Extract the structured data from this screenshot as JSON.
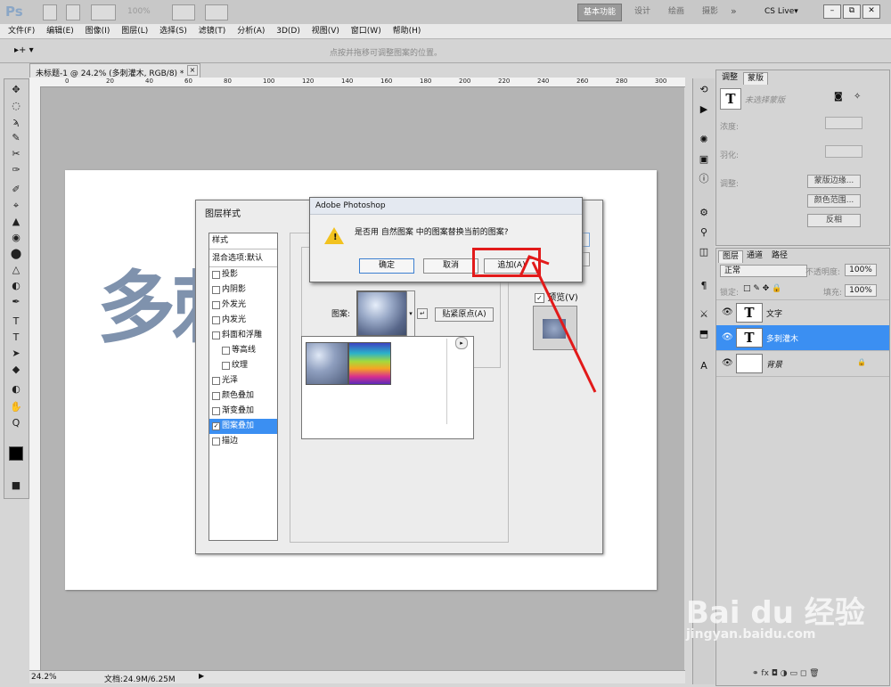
{
  "appbar": {
    "logo": "Ps",
    "zoom_field": "100%",
    "workspaces": [
      "基本功能",
      "设计",
      "绘画",
      "摄影"
    ],
    "more": "»",
    "cs_live": "CS Live▾",
    "win_min": "–",
    "win_max": "⧉",
    "win_close": "✕"
  },
  "menu": [
    "文件(F)",
    "编辑(E)",
    "图像(I)",
    "图层(L)",
    "选择(S)",
    "滤镜(T)",
    "分析(A)",
    "3D(D)",
    "视图(V)",
    "窗口(W)",
    "帮助(H)"
  ],
  "options": {
    "tool_glyph": "▸+ ▾",
    "hint": "点按并拖移可调整图案的位置。"
  },
  "tools": [
    "✥",
    "◌",
    "ϡ",
    "✎",
    "✂",
    "✑",
    "✐",
    "⌖",
    "▲",
    "◉",
    "⬤",
    "△",
    "◐",
    "✒",
    "T",
    "➤",
    "◆",
    "✋",
    "Q",
    "■"
  ],
  "document": {
    "tab_title": "未标题-1 @ 24.2% (多刺灌木, RGB/8) *",
    "tab_close": "×",
    "ruler_h": [
      "0",
      "20",
      "40",
      "60",
      "80",
      "100",
      "120",
      "140",
      "160",
      "180",
      "200",
      "220",
      "240",
      "260",
      "280",
      "300"
    ],
    "ruler_v": [
      "0",
      "2",
      "4",
      "6",
      "8",
      "1",
      "1",
      "1",
      "1",
      "1",
      "2",
      "2",
      "2",
      "2",
      "2",
      "3",
      "3"
    ],
    "canvas_text": "多刺灌木"
  },
  "status": {
    "zoom": "24.2%",
    "doc_size": "文档:24.9M/6.25M"
  },
  "masks_panel": {
    "tabs": [
      "调整",
      "蒙版"
    ],
    "no_mask": "未选择蒙版",
    "density": "浓度:",
    "feather": "羽化:",
    "refine": "调整:",
    "btn_edge": "蒙版边缘...",
    "btn_color_range": "颜色范围...",
    "btn_invert": "反相"
  },
  "layers_panel": {
    "tabs": [
      "图层",
      "通道",
      "路径"
    ],
    "blend_mode": "正常",
    "opacity_label": "不透明度:",
    "opacity": "100%",
    "lock_label": "锁定:",
    "fill_label": "填充:",
    "fill": "100%",
    "layers": [
      {
        "name": "文字",
        "thumb": "T"
      },
      {
        "name": "多刺灌木",
        "thumb": "T"
      },
      {
        "name": "背景",
        "thumb": ""
      }
    ],
    "lock_icon": "🔒",
    "bottom_icons": "⚭ fx ◘ ◑ ▭ ◻ 🗑"
  },
  "layer_style": {
    "title": "图层样式",
    "styles_header": "样式",
    "items": [
      {
        "label": "混合选项:默认",
        "cb": false,
        "checked": false
      },
      {
        "label": "投影",
        "cb": true,
        "checked": false
      },
      {
        "label": "内阴影",
        "cb": true,
        "checked": false
      },
      {
        "label": "外发光",
        "cb": true,
        "checked": false
      },
      {
        "label": "内发光",
        "cb": true,
        "checked": false
      },
      {
        "label": "斜面和浮雕",
        "cb": true,
        "checked": false
      },
      {
        "label": "等高线",
        "cb": true,
        "checked": false
      },
      {
        "label": "纹理",
        "cb": true,
        "checked": false
      },
      {
        "label": "光泽",
        "cb": true,
        "checked": false
      },
      {
        "label": "颜色叠加",
        "cb": true,
        "checked": false
      },
      {
        "label": "渐变叠加",
        "cb": true,
        "checked": false
      },
      {
        "label": "图案叠加",
        "cb": true,
        "checked": true
      },
      {
        "label": "描边",
        "cb": true,
        "checked": false
      }
    ],
    "pattern_label": "图案:",
    "snap_origin": "贴紧原点(A)",
    "preview": "预览(V)",
    "check_mark": "✓"
  },
  "alert": {
    "title": "Adobe Photoshop",
    "message": "是否用 自然图案 中的图案替换当前的图案?",
    "ok": "确定",
    "cancel": "取消",
    "append": "追加(A)"
  },
  "watermark": {
    "logo": "Bai du 经验",
    "url": "jingyan.baidu.com"
  },
  "colors": {
    "accent": "#3b8ff2",
    "highlight": "#e21a1a",
    "warning": "#f2c21f"
  }
}
